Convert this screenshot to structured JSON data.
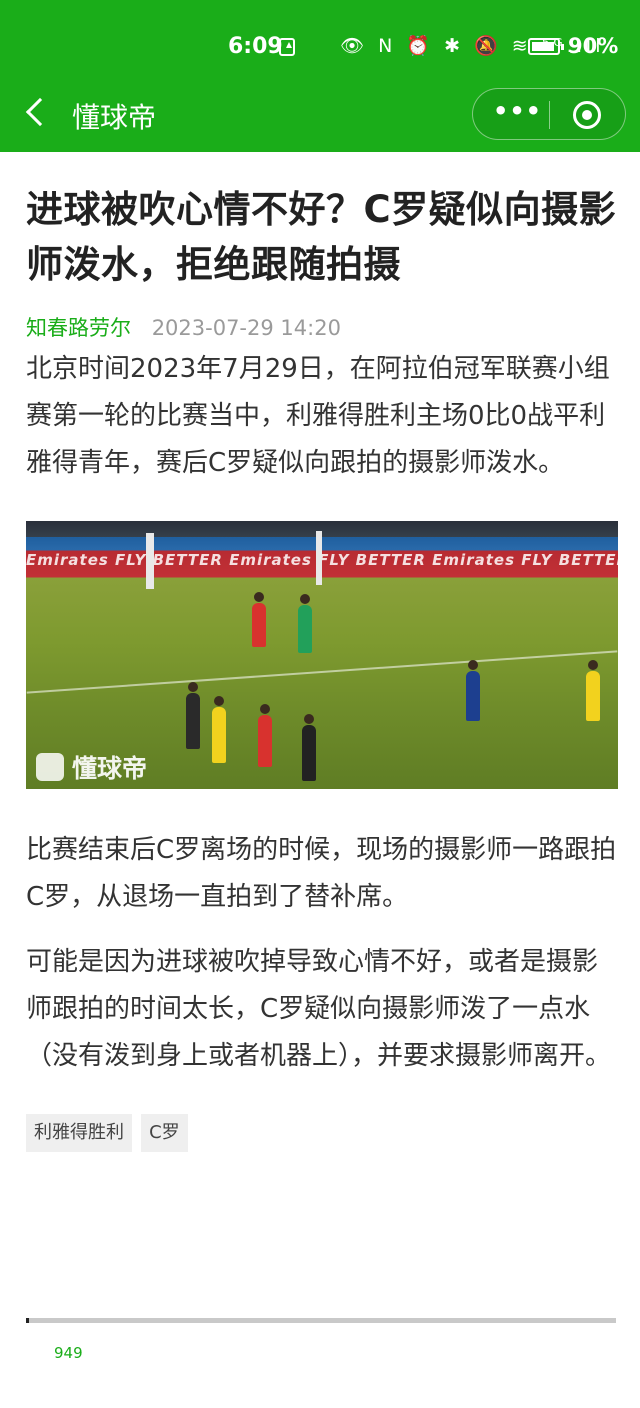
{
  "status_bar": {
    "time": "6:09",
    "icons": "👁 N ⏰ ✱ 🔕 ≋ ⁵ᴳ.ıll",
    "battery_percent": "90%",
    "battery_level": 0.9
  },
  "nav": {
    "title": "懂球帝",
    "more_label": "•••",
    "accent_color": "#1aad19"
  },
  "article": {
    "title": "进球被吹心情不好？C罗疑似向摄影师泼水，拒绝跟随拍摄",
    "author": "知春路劳尔",
    "date": "2023-07-29 14:20",
    "paragraphs": [
      "北京时间2023年7月29日，在阿拉伯冠军联赛小组赛第一轮的比赛当中，利雅得胜利主场0比0战平利雅得青年，赛后C罗疑似向跟拍的摄影师泼水。",
      "比赛结束后C罗离场的时候，现场的摄影师一路跟拍C罗，从退场一直拍到了替补席。",
      "可能是因为进球被吹掉导致心情不好，或者是摄影师跟拍的时间太长，C罗疑似向摄影师泼了一点水（没有泼到身上或者机器上），并要求摄影师离开。"
    ],
    "image": {
      "banner_text": "Emirates FLY BETTER Emirates FLY BETTER Emirates FLY BETTER Emirates FLY BETTER Emirates",
      "watermark": "懂球帝"
    },
    "tags": [
      "利雅得胜利",
      "C罗"
    ]
  },
  "footer": {
    "read_count": "949"
  }
}
